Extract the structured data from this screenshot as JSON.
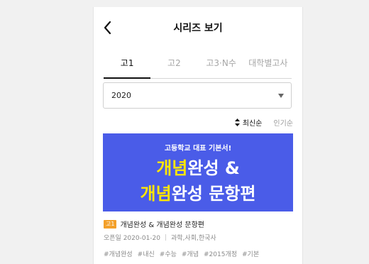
{
  "header": {
    "title": "시리즈 보기",
    "back_icon": "chevron-left-icon"
  },
  "tabs": [
    {
      "label": "고1",
      "active": true
    },
    {
      "label": "고2",
      "active": false
    },
    {
      "label": "고3·N수",
      "active": false
    },
    {
      "label": "대학별고사",
      "active": false
    }
  ],
  "year_select": {
    "value": "2020",
    "caret_icon": "caret-down-icon"
  },
  "sort": {
    "latest_label": "최신순",
    "popular_label": "인기순",
    "sort_icon": "sort-arrows-icon"
  },
  "banner": {
    "tagline": "고등학교 대표 기본서!",
    "line1_highlight": "개념",
    "line1_rest": "완성 &",
    "line2_highlight": "개념",
    "line2_rest": "완성 문항편",
    "colors": {
      "background": "#4a5ce8",
      "highlight": "#ffe600"
    }
  },
  "book": {
    "grade_badge": "고1",
    "title": "개념완성 & 개념완성 문항편",
    "open_date": "오픈일 2020-01-20",
    "subjects": "과학,사회,한국사",
    "hashtags": [
      "#개념완성",
      "#내신",
      "#수능",
      "#개념",
      "#2015개정",
      "#기본"
    ]
  }
}
